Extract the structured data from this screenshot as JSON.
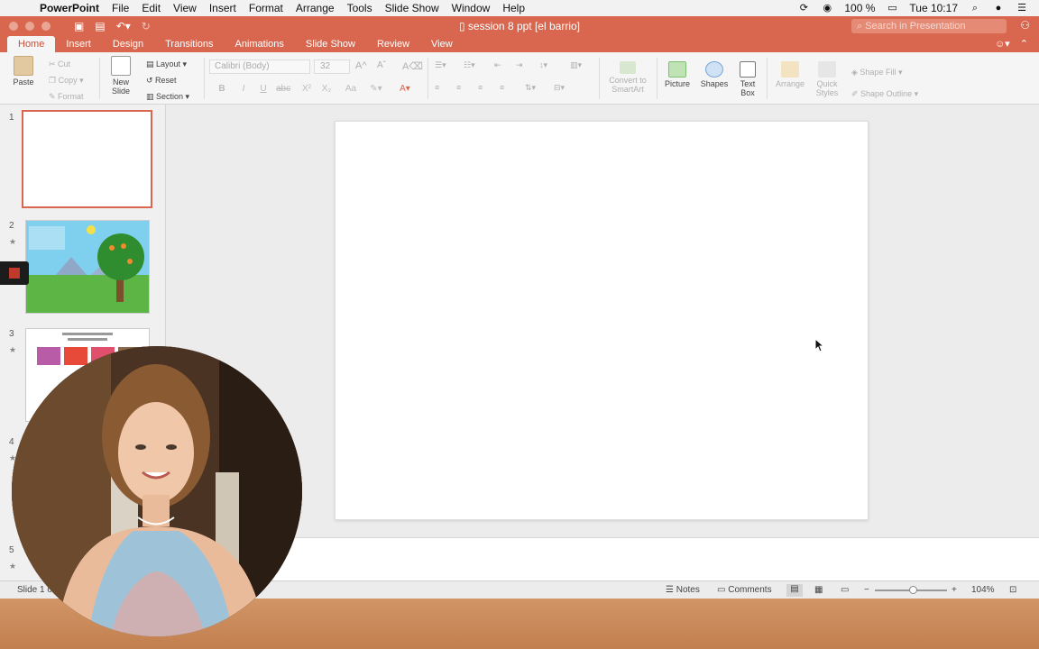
{
  "menubar": {
    "app": "PowerPoint",
    "items": [
      "File",
      "Edit",
      "View",
      "Insert",
      "Format",
      "Arrange",
      "Tools",
      "Slide Show",
      "Window",
      "Help"
    ],
    "battery": "100 %",
    "clock": "Tue 10:17"
  },
  "window": {
    "doc_title": "session 8 ppt [el barrio]",
    "search_placeholder": "Search in Presentation"
  },
  "tabs": [
    "Home",
    "Insert",
    "Design",
    "Transitions",
    "Animations",
    "Slide Show",
    "Review",
    "View"
  ],
  "active_tab": "Home",
  "ribbon": {
    "paste": "Paste",
    "cut": "Cut",
    "copy": "Copy",
    "format": "Format",
    "new_slide": [
      "New",
      "Slide"
    ],
    "layout": "Layout",
    "reset": "Reset",
    "section": "Section",
    "font_name": "Calibri (Body)",
    "font_size": "32",
    "convert": [
      "Convert to",
      "SmartArt"
    ],
    "picture": "Picture",
    "shapes": "Shapes",
    "text_box": [
      "Text",
      "Box"
    ],
    "arrange": "Arrange",
    "quick_styles": [
      "Quick",
      "Styles"
    ],
    "shape_fill": "Shape Fill",
    "shape_outline": "Shape Outline"
  },
  "slides": [
    {
      "num": "1"
    },
    {
      "num": "2"
    },
    {
      "num": "3"
    },
    {
      "num": "4"
    },
    {
      "num": "5"
    }
  ],
  "status": {
    "slide_info": "Slide 1 of",
    "notes": "Notes",
    "comments": "Comments",
    "zoom": "104%",
    "zoom_level": 0.52
  },
  "colors": {
    "accent": "#d9674f"
  }
}
